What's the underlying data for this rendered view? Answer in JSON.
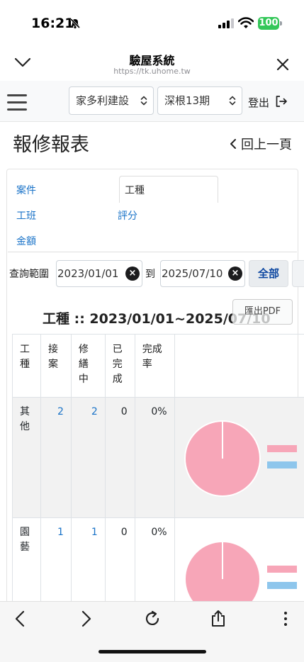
{
  "status_bar": {
    "time": "16:21",
    "battery": "100",
    "battery_color": "#34c759"
  },
  "browser": {
    "title": "驗屋系統",
    "url": "https://tk.uhome.tw"
  },
  "navbar": {
    "company_select": "家多利建設",
    "project_select": "深根13期",
    "logout_label": "登出"
  },
  "page": {
    "title": "報修報表",
    "back_label": "回上一頁"
  },
  "tabs": [
    {
      "label": "案件"
    },
    {
      "label": "工種"
    },
    {
      "label": "工班"
    },
    {
      "label": "評分"
    },
    {
      "label": "金額"
    }
  ],
  "query": {
    "label": "查詢範圍",
    "date_from": "2023/01/01",
    "to_label": "到",
    "date_to": "2025/07/10",
    "all_button": "全部"
  },
  "report": {
    "title": "工種 :: 2023/01/01~2025/07/10",
    "pdf_button": "匯出PDF"
  },
  "table": {
    "headers": [
      "工種",
      "接案",
      "修繕中",
      "已完成",
      "完成率",
      ""
    ],
    "header_lines": [
      [
        "工",
        "種"
      ],
      [
        "接",
        "案"
      ],
      [
        "修",
        "繕",
        "中"
      ],
      [
        "已",
        "完",
        "成"
      ],
      [
        "完成",
        "率"
      ]
    ],
    "rows": [
      {
        "trade_lines": [
          "其",
          "他"
        ],
        "received": "2",
        "in_repair": "2",
        "completed": "0",
        "rate": "0%",
        "pie_share_in_repair": 1.0
      },
      {
        "trade_lines": [
          "園",
          "藝"
        ],
        "received": "1",
        "in_repair": "1",
        "completed": "0",
        "rate": "0%",
        "pie_share_in_repair": 1.0
      }
    ]
  },
  "colors": {
    "link": "#1a73c8",
    "pie_pink": "#f7a6b8",
    "legend_blue": "#8ec6ec"
  }
}
